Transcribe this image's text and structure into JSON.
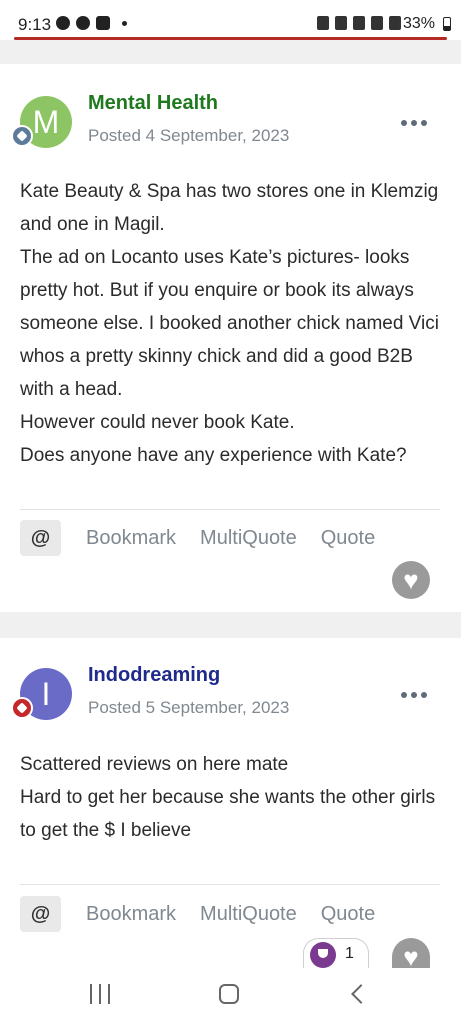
{
  "status_bar": {
    "time": "9:13",
    "battery": "33%",
    "accent_color": "#b52a24"
  },
  "posts": [
    {
      "author": "Mental Health",
      "avatar_letter": "M",
      "author_color": "#1f7a1f",
      "date": "Posted 4 September, 2023",
      "body": [
        "Kate Beauty & Spa has two stores one in Klemzig and one in Magil.",
        "The ad on Locanto uses Kate’s pictures- looks pretty hot. But if you enquire or book its always someone else. I booked another chick named Vici whos a pretty skinny chick and did a good B2B with a head.",
        "However could never book Kate.",
        "Does anyone have any experience with Kate?"
      ],
      "actions": {
        "mention": "@",
        "bookmark": "Bookmark",
        "multiquote": "MultiQuote",
        "quote": "Quote"
      }
    },
    {
      "author": "Indodreaming",
      "avatar_letter": "I",
      "author_color": "#1f2a8c",
      "date": "Posted 5 September, 2023",
      "body": [
        "Scattered reviews on here mate",
        "Hard to get her because she wants the other girls to get the $ I believe"
      ],
      "actions": {
        "mention": "@",
        "bookmark": "Bookmark",
        "multiquote": "MultiQuote",
        "quote": "Quote"
      },
      "reaction_count": "1"
    }
  ],
  "icons": [
    "chat-icon",
    "telegram-icon",
    "instagram-icon",
    "alarm-icon",
    "bluetooth-icon",
    "mute-icon",
    "wifi-icon",
    "signal-icon",
    "battery-icon",
    "more-icon",
    "heart-icon",
    "trophy-icon"
  ]
}
